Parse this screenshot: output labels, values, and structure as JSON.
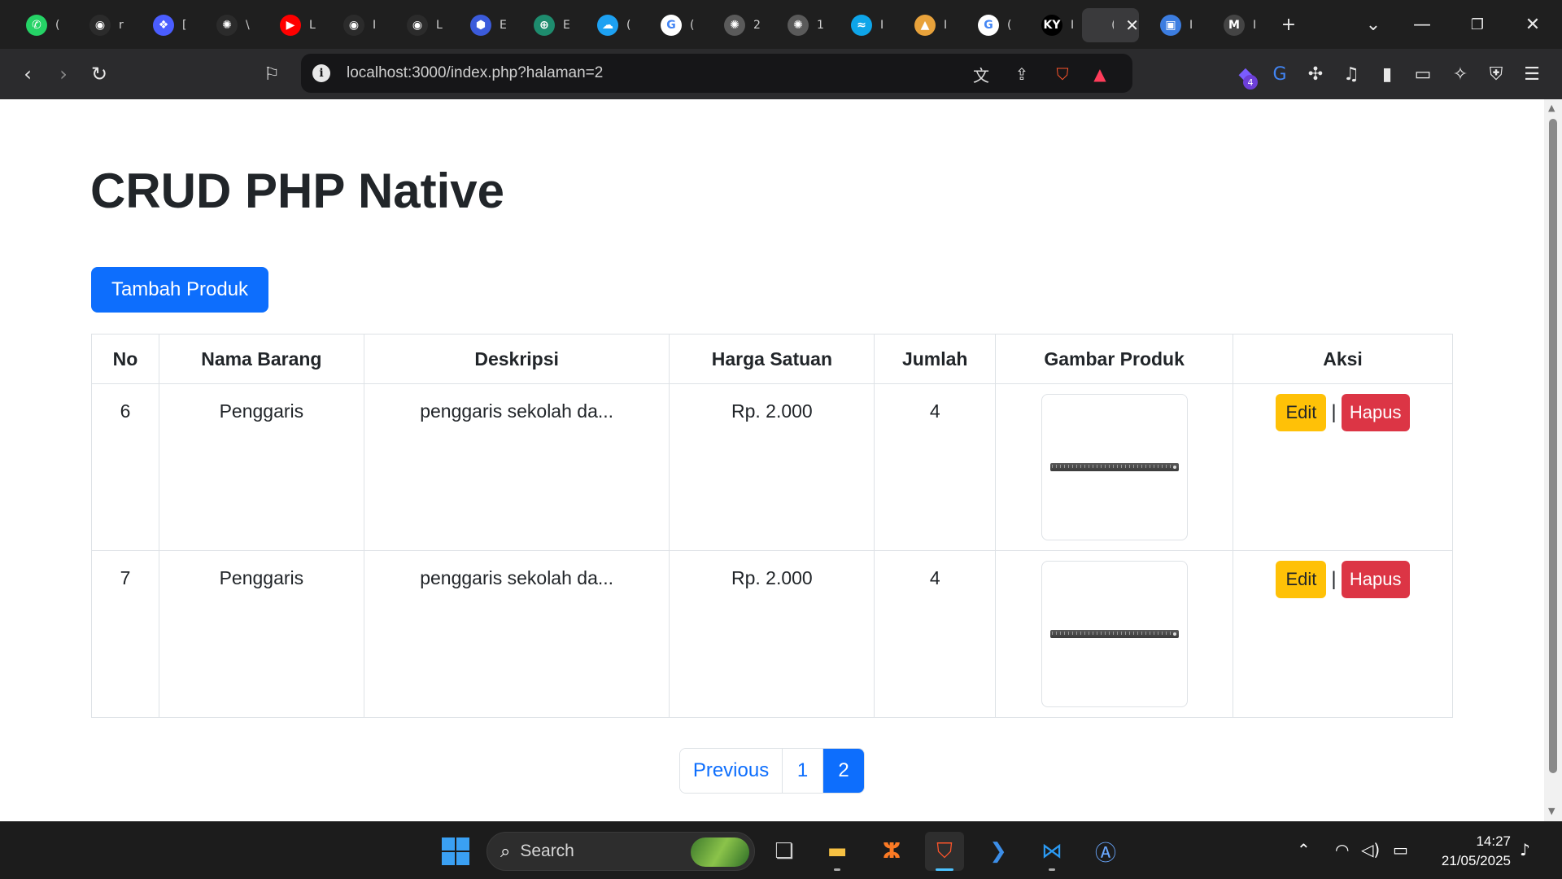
{
  "browser": {
    "url": "localhost:3000/index.php?halaman=2",
    "tabs": [
      {
        "icon": "whatsapp-icon",
        "color": "#25d366",
        "glyph": "✆",
        "label": "("
      },
      {
        "icon": "github-icon",
        "color": "#2b2b2b",
        "glyph": "◉",
        "label": "r"
      },
      {
        "icon": "brain-icon",
        "color": "#4a5dff",
        "glyph": "❖",
        "label": "["
      },
      {
        "icon": "openai-icon",
        "color": "#2b2b2b",
        "glyph": "✺",
        "label": "\\"
      },
      {
        "icon": "youtube-icon",
        "color": "#ff0000",
        "glyph": "▶",
        "label": "L"
      },
      {
        "icon": "github-icon",
        "color": "#2b2b2b",
        "glyph": "◉",
        "label": "I"
      },
      {
        "icon": "github-icon",
        "color": "#2b2b2b",
        "glyph": "◉",
        "label": "L"
      },
      {
        "icon": "hexagon-app-icon",
        "color": "#3b5bdb",
        "glyph": "⬢",
        "label": "E"
      },
      {
        "icon": "globe-app-icon",
        "color": "#1e8c6e",
        "glyph": "⊕",
        "label": "E"
      },
      {
        "icon": "cloud-app-icon",
        "color": "#1da1f2",
        "glyph": "☁",
        "label": "("
      },
      {
        "icon": "google-icon",
        "color": "#ffffff",
        "glyph": "G",
        "label": "("
      },
      {
        "icon": "openai-icon",
        "color": "#5a5a5a",
        "glyph": "✺",
        "label": "2"
      },
      {
        "icon": "openai-icon",
        "color": "#5a5a5a",
        "glyph": "✺",
        "label": "1"
      },
      {
        "icon": "tailwind-icon",
        "color": "#0ea5e9",
        "glyph": "≈",
        "label": "I"
      },
      {
        "icon": "mountain-app-icon",
        "color": "#e8a23b",
        "glyph": "▲",
        "label": "I"
      },
      {
        "icon": "google-icon",
        "color": "#ffffff",
        "glyph": "G",
        "label": "("
      },
      {
        "icon": "ky-app-icon",
        "color": "#000000",
        "glyph": "KY",
        "label": "I"
      },
      {
        "icon": "blank-icon",
        "color": "#3a3a3c",
        "glyph": "",
        "label": "("
      },
      {
        "icon": "contacts-app-icon",
        "color": "#3c7de0",
        "glyph": "▣",
        "label": "I"
      },
      {
        "icon": "m-app-icon",
        "color": "#444444",
        "glyph": "M",
        "label": "I"
      }
    ]
  },
  "page": {
    "title": "CRUD PHP Native",
    "add_button": "Tambah Produk",
    "table": {
      "headers": [
        "No",
        "Nama Barang",
        "Deskripsi",
        "Harga Satuan",
        "Jumlah",
        "Gambar Produk",
        "Aksi"
      ],
      "rows": [
        {
          "no": "6",
          "nama": "Penggaris",
          "deskripsi": "penggaris sekolah da...",
          "harga": "Rp. 2.000",
          "jumlah": "4",
          "gambar": "ruler-image"
        },
        {
          "no": "7",
          "nama": "Penggaris",
          "deskripsi": "penggaris sekolah da...",
          "harga": "Rp. 2.000",
          "jumlah": "4",
          "gambar": "ruler-image"
        }
      ],
      "edit_label": "Edit",
      "delete_label": "Hapus",
      "separator": "|"
    },
    "pagination": {
      "previous": "Previous",
      "pages": [
        "1",
        "2"
      ],
      "active_page": "2"
    }
  },
  "taskbar": {
    "search_placeholder": "Search",
    "time": "14:27",
    "date": "21/05/2025",
    "extension_badge": "4"
  },
  "colors": {
    "primary": "#0d6efd",
    "warning": "#ffc107",
    "danger": "#dc3545"
  }
}
